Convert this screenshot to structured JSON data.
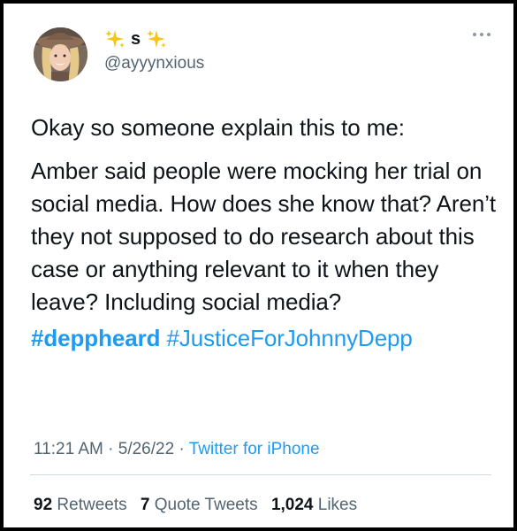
{
  "tweet": {
    "display_name": "s",
    "handle": "@ayyynxious",
    "sparkle_emoji": "sparkles-icon",
    "paragraph1": "Okay so someone explain this to me:",
    "paragraph2": "Amber said people were mocking her trial on social media. How does she know that? Aren’t they not supposed to do research about this case or anything relevant to it when they leave? Including social media?",
    "hashtags": [
      "#deppheard",
      "#JusticeForJohnnyDepp"
    ],
    "time": "11:21 AM",
    "date": "5/26/22",
    "source": "Twitter for iPhone",
    "separator": "·"
  },
  "stats": {
    "retweets_count": "92",
    "retweets_label": "Retweets",
    "quote_count": "7",
    "quote_label": "Quote Tweets",
    "likes_count": "1,024",
    "likes_label": "Likes"
  },
  "colors": {
    "link": "#1d9bf0",
    "secondary_text": "#536471",
    "primary_text": "#0f1419",
    "divider": "#cfd9de",
    "border": "#000000"
  }
}
